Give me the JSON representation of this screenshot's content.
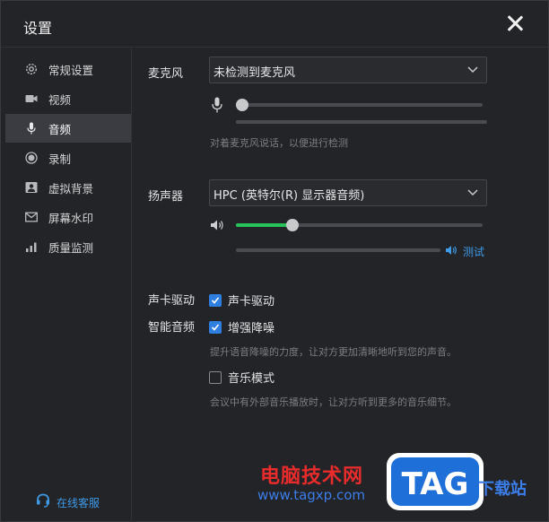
{
  "window": {
    "title": "设置"
  },
  "sidebar": {
    "items": [
      {
        "label": "常规设置",
        "icon": "gear-icon"
      },
      {
        "label": "视频",
        "icon": "video-camera-icon"
      },
      {
        "label": "音频",
        "icon": "microphone-icon",
        "active": true
      },
      {
        "label": "录制",
        "icon": "record-icon"
      },
      {
        "label": "虚拟背景",
        "icon": "portrait-icon"
      },
      {
        "label": "屏幕水印",
        "icon": "envelope-icon"
      },
      {
        "label": "质量监测",
        "icon": "signal-bars-icon"
      }
    ],
    "support_label": "在线客服"
  },
  "audio": {
    "mic": {
      "label": "麦克风",
      "selected": "未检测到麦克风",
      "volume": 0.0,
      "level": 0.0,
      "hint": "对着麦克风说话，以便进行检测"
    },
    "speaker": {
      "label": "扬声器",
      "selected": "HPC (英特尔(R) 显示器音频)",
      "volume": 0.23,
      "level": 0.0,
      "test_label": "测试"
    },
    "driver": {
      "label": "声卡驱动",
      "checkbox_label": "声卡驱动",
      "checked": true
    },
    "smart": {
      "label": "智能音频",
      "noise_label": "增强降噪",
      "noise_checked": true,
      "noise_hint": "提升语音降噪的力度，让对方更加清晰地听到您的声音。",
      "music_label": "音乐模式",
      "music_checked": false,
      "music_hint": "会议中有外部音乐播放时，让对方听到更多的音乐细节。"
    }
  },
  "watermark": {
    "cn_text": "电脑技术网",
    "url_text": "www.tagxp.com",
    "badge_text": "TAG",
    "xz_text": "下载站"
  },
  "colors": {
    "accent_blue": "#2f7fe0",
    "link_blue": "#3f9ae8",
    "slider_green": "#27c25a",
    "background": "#232427"
  }
}
